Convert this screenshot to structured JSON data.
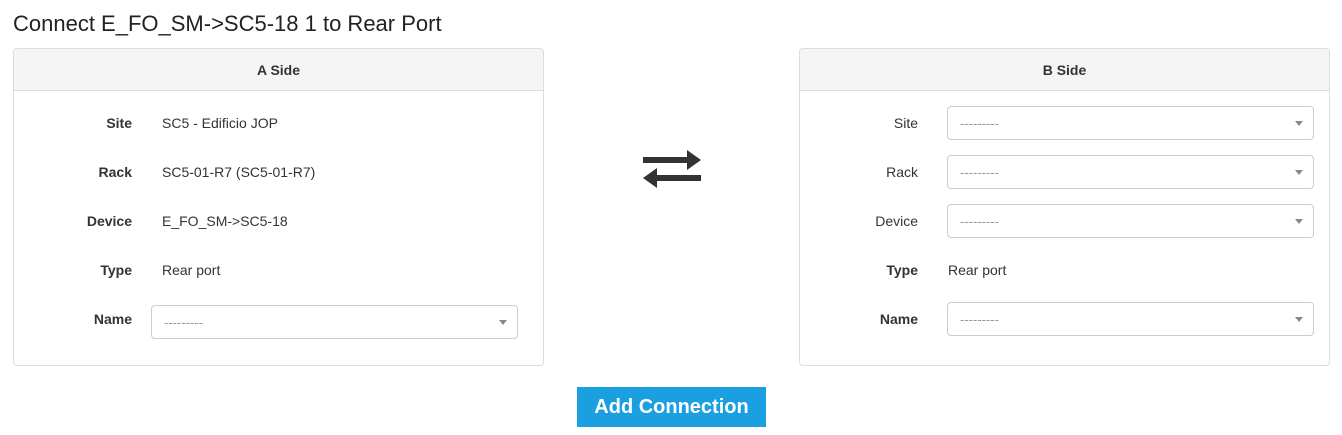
{
  "page": {
    "title": "Connect E_FO_SM->SC5-18 1 to Rear Port"
  },
  "a_side": {
    "heading": "A Side",
    "site_label": "Site",
    "site_value": "SC5 - Edificio JOP",
    "rack_label": "Rack",
    "rack_value": "SC5-01-R7 (SC5-01-R7)",
    "device_label": "Device",
    "device_value": "E_FO_SM->SC5-18",
    "type_label": "Type",
    "type_value": "Rear port",
    "name_label": "Name",
    "name_select": "---------"
  },
  "b_side": {
    "heading": "B Side",
    "site_label": "Site",
    "site_select": "---------",
    "rack_label": "Rack",
    "rack_select": "---------",
    "device_label": "Device",
    "device_select": "---------",
    "type_label": "Type",
    "type_value": "Rear port",
    "name_label": "Name",
    "name_select": "---------"
  },
  "actions": {
    "swap_icon": "swap-arrows-icon",
    "add_connection_label": "Add Connection"
  },
  "colors": {
    "primary_button": "#1a9fe0",
    "panel_heading_bg": "#f5f5f5",
    "border": "#dddddd"
  }
}
